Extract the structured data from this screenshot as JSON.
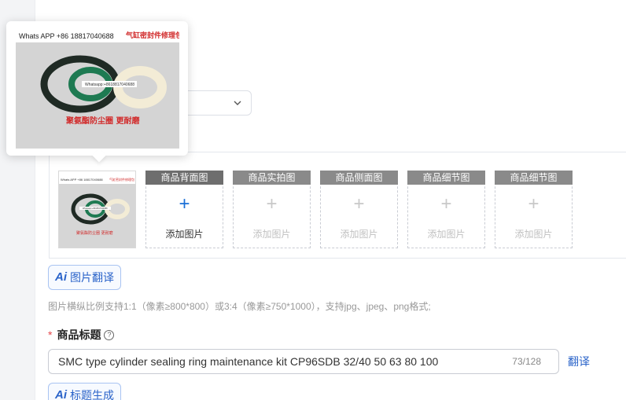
{
  "image_section": {
    "main_thumb": {
      "banner_left": "Whats APP +86 18817040688",
      "banner_right": "气缸密封件修理包",
      "watermark": "Whatsapp:+8618817040688",
      "caption": "聚氨酯防尘圈 更耐磨"
    },
    "slots": [
      {
        "header": "商品背面图",
        "label": "添加图片",
        "state": "active"
      },
      {
        "header": "商品实拍图",
        "label": "添加图片",
        "state": "inactive"
      },
      {
        "header": "商品侧面图",
        "label": "添加图片",
        "state": "inactive"
      },
      {
        "header": "商品细节图",
        "label": "添加图片",
        "state": "inactive"
      },
      {
        "header": "商品细节图",
        "label": "添加图片",
        "state": "inactive"
      }
    ],
    "plus_symbol": "+"
  },
  "image_translate_button": {
    "ai": "Ai",
    "label": "图片翻译"
  },
  "hint": "图片横纵比例支持1:1（像素≥800*800）或3:4（像素≥750*1000），支持jpg、jpeg、png格式;",
  "title_field": {
    "required_mark": "*",
    "label": "商品标题",
    "help": "?",
    "value": "SMC type cylinder sealing ring maintenance kit CP96SDB 32/40 50 63 80 100",
    "counter": "73/128",
    "translate_link": "翻译"
  },
  "title_generate_button": {
    "ai": "Ai",
    "label": "标题生成"
  },
  "popover": {
    "banner_left": "Whats APP +86 18817040688",
    "banner_right": "气缸密封件修理包",
    "watermark": "Whatsapp:+8618817040688",
    "caption": "聚氨酯防尘圈 更耐磨"
  },
  "colors": {
    "accent": "#2a63c9",
    "required": "#e5484d",
    "slot_header": "#7b7b7b",
    "seal_black": "#1f2a24",
    "seal_green": "#1e7a52",
    "seal_cream": "#f3ecd6",
    "banner_red": "#d12a2a"
  },
  "icons": {
    "dropdown": "chevron-down-icon",
    "help": "question-circle-icon"
  }
}
